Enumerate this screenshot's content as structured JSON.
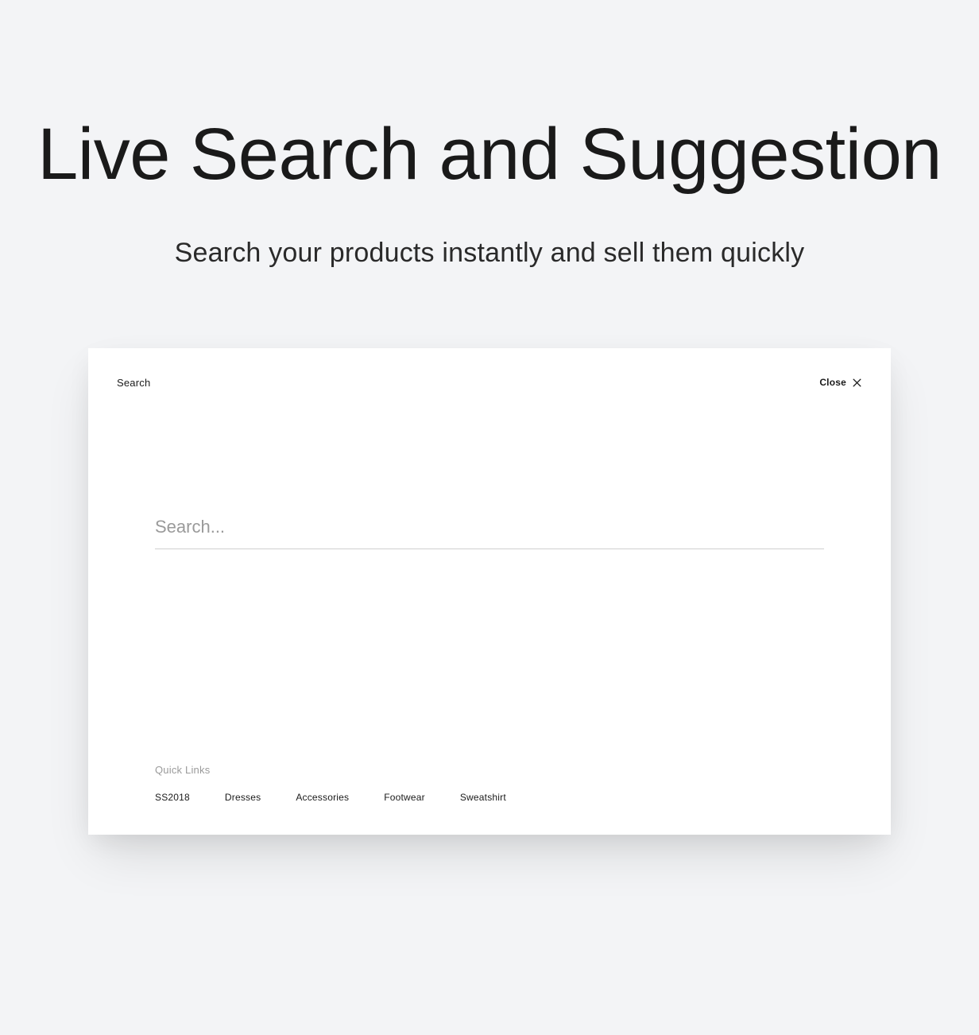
{
  "hero": {
    "title": "Live Search and Suggestion",
    "subtitle": "Search your products instantly and sell them quickly"
  },
  "panel": {
    "search_label": "Search",
    "close_label": "Close",
    "search_placeholder": "Search...",
    "search_value": "",
    "quick_links_title": "Quick Links",
    "quick_links": [
      "SS2018",
      "Dresses",
      "Accessories",
      "Footwear",
      "Sweatshirt"
    ]
  }
}
